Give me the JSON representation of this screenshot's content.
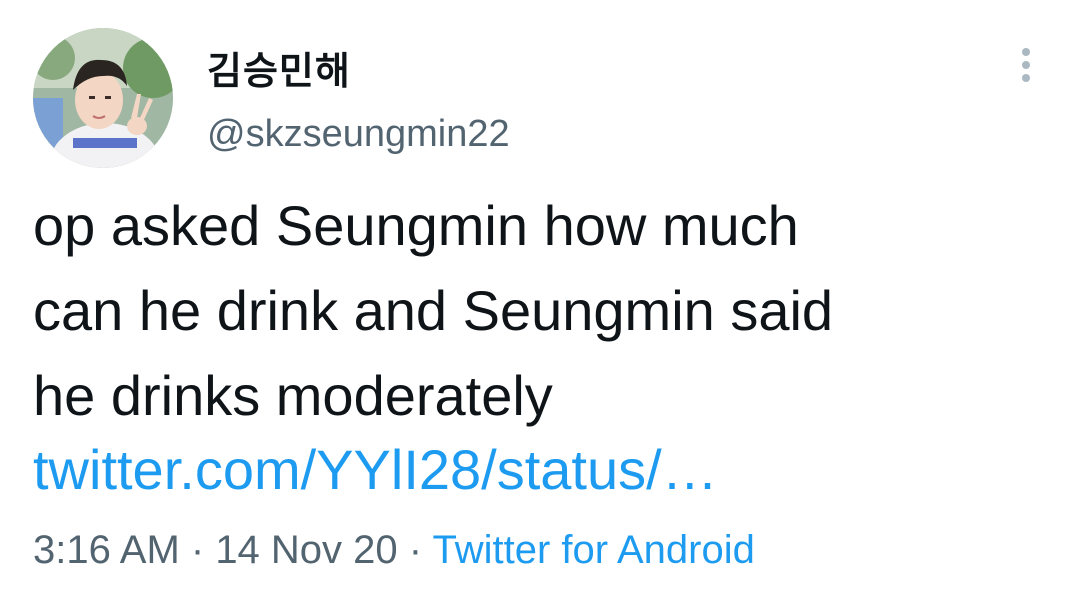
{
  "author": {
    "display_name": "김승민해",
    "handle": "@skzseungmin22"
  },
  "tweet": {
    "text_lines": [
      "op asked Seungmin how much",
      "can he drink and Seungmin said",
      "he drinks moderately"
    ],
    "link_text": "twitter.com/YYlI28/status/…"
  },
  "meta": {
    "time": "3:16 AM",
    "separator": " · ",
    "date": "14 Nov 20",
    "source": "Twitter for Android"
  },
  "colors": {
    "link": "#1d9bf0",
    "secondary_text": "#536471",
    "primary_text": "#0f1419"
  },
  "icons": {
    "more": "more-vertical-icon"
  }
}
